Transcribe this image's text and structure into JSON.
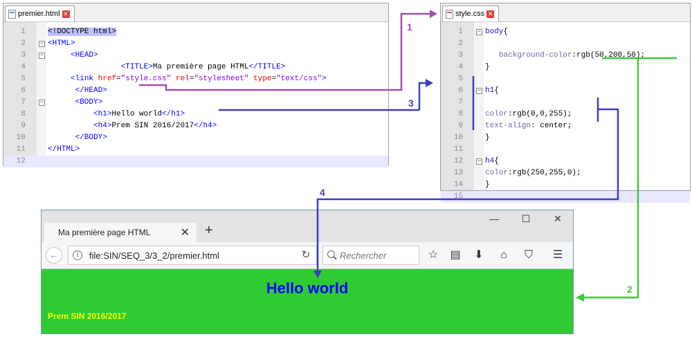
{
  "html_editor": {
    "tab_label": "premier.html",
    "lines": [
      {
        "n": "1",
        "html": "<span class=\"dt\">&lt;!DOCTYPE html&gt;</span>"
      },
      {
        "n": "2",
        "html": "<span class=\"tag\">&lt;HTML&gt;</span>"
      },
      {
        "n": "3",
        "html": "     <span class=\"tag\">&lt;HEAD&gt;</span>"
      },
      {
        "n": "4",
        "html": "                <span class=\"tag\">&lt;TITLE&gt;</span><span class=\"plain\">Ma première page HTML</span><span class=\"tag\">&lt;/TITLE&gt;</span>"
      },
      {
        "n": "5",
        "html": "     <span class=\"tag\">&lt;link </span><span class=\"attr\">href</span><span class=\"plain\">=</span><span class=\"val\">\"style.css\"</span> <span class=\"attr\">rel</span><span class=\"plain\">=</span><span class=\"val\">\"stylesheet\"</span> <span class=\"attr\">type</span><span class=\"plain\">=</span><span class=\"val\">\"text/css\"</span><span class=\"tag\">&gt;</span>"
      },
      {
        "n": "6",
        "html": "      <span class=\"tag\">&lt;/HEAD&gt;</span>"
      },
      {
        "n": "7",
        "html": "      <span class=\"tag\">&lt;BODY&gt;</span>"
      },
      {
        "n": "8",
        "html": "          <span class=\"tag\">&lt;h1&gt;</span><span class=\"plain\">Hello world</span><span class=\"tag\">&lt;/h1&gt;</span>"
      },
      {
        "n": "9",
        "html": "          <span class=\"tag\">&lt;h4&gt;</span><span class=\"plain\">Prem SIN 2016/2017</span><span class=\"tag\">&lt;/h4&gt;</span>"
      },
      {
        "n": "10",
        "html": "      <span class=\"tag\">&lt;/BODY&gt;</span>"
      },
      {
        "n": "11",
        "html": "<span class=\"tag\">&lt;/HTML&gt;</span>"
      },
      {
        "n": "12",
        "html": ""
      }
    ]
  },
  "css_editor": {
    "tab_label": "style.css",
    "lines": [
      {
        "n": "1",
        "html": "<span class=\"sel\">body</span><span class=\"plain\">{</span>"
      },
      {
        "n": "2",
        "html": ""
      },
      {
        "n": "3",
        "html": "   <span class=\"prop\">background-color</span><span class=\"plain\">:rgb(50,200,50);</span>"
      },
      {
        "n": "4",
        "html": "<span class=\"plain\">}</span>"
      },
      {
        "n": "5",
        "html": ""
      },
      {
        "n": "6",
        "html": "<span class=\"sel\">h1</span><span class=\"plain\">{</span>"
      },
      {
        "n": "7",
        "html": ""
      },
      {
        "n": "8",
        "html": "<span class=\"prop\">color</span><span class=\"plain\">:rgb(0,0,255);</span>"
      },
      {
        "n": "9",
        "html": "<span class=\"prop\">text-align</span><span class=\"plain\">: center;</span>"
      },
      {
        "n": "10",
        "html": "<span class=\"plain\">}</span>"
      },
      {
        "n": "11",
        "html": ""
      },
      {
        "n": "12",
        "html": "<span class=\"sel\">h4</span><span class=\"plain\">{</span>"
      },
      {
        "n": "13",
        "html": "<span class=\"prop\">color</span><span class=\"plain\">:rgb(250,255,0);</span>"
      },
      {
        "n": "14",
        "html": "<span class=\"plain\">}</span>"
      },
      {
        "n": "15",
        "html": ""
      }
    ]
  },
  "browser": {
    "tab_title": "Ma première page HTML",
    "tab_close": "✕",
    "new_tab": "+",
    "url": "file:SIN/SEQ_3/3_2/premier.html",
    "search_placeholder": "Rechercher",
    "page": {
      "h1": "Hello world",
      "h4": "Prem SIN 2016/2017"
    },
    "colors": {
      "page_background": "#32c832",
      "h1": "#0000ff",
      "h4": "#faff00"
    }
  },
  "annotations": {
    "labels": [
      "1",
      "2",
      "3",
      "4"
    ],
    "colors": {
      "arrow1": "#a050a8",
      "arrow2": "#3cc83c",
      "arrow3": "#3c3cc0",
      "arrow4": "#3c3cc0"
    }
  }
}
